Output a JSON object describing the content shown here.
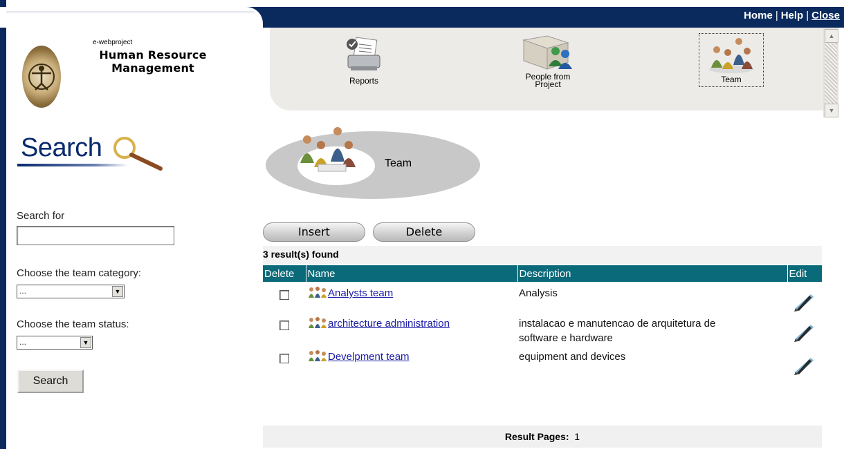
{
  "header": {
    "links": [
      {
        "label": "Home"
      },
      {
        "label": "Help"
      },
      {
        "label": "Close"
      }
    ]
  },
  "logo": {
    "small_text": "e-webproject",
    "line1": "Human Resource",
    "line2": "Management"
  },
  "toolbar": {
    "items": [
      {
        "label": "Reports",
        "icon": "printer-report-icon"
      },
      {
        "label_line1": "People from",
        "label_line2": "Project",
        "icon": "people-project-icon"
      },
      {
        "label": "Team",
        "icon": "team-icon"
      }
    ]
  },
  "sidebar": {
    "title": "Search",
    "search_for_label": "Search for",
    "search_for_value": "",
    "category_label": "Choose the team category:",
    "category_value": "...",
    "status_label": "Choose the team status:",
    "status_value": "...",
    "search_button": "Search"
  },
  "main": {
    "banner_title": "Team",
    "insert_button": "Insert",
    "delete_button": "Delete",
    "results_count": "3 result(s) found",
    "columns": [
      "Delete",
      "Name",
      "Description",
      "Edit"
    ],
    "rows": [
      {
        "name": "Analysts team",
        "description_line1": "Analysis",
        "description_line2": ""
      },
      {
        "name": "architecture administration",
        "description_line1": "instalacao e manutencao de arquitetura de",
        "description_line2": "software e hardware"
      },
      {
        "name": "Develpment team",
        "description_line1": "equipment and devices",
        "description_line2": ""
      }
    ],
    "result_pages_label": "Result Pages:",
    "result_pages_value": "1"
  },
  "colors": {
    "navy": "#0a2a5e",
    "table_header": "#0b6a7a",
    "link": "#1a1aa6"
  }
}
